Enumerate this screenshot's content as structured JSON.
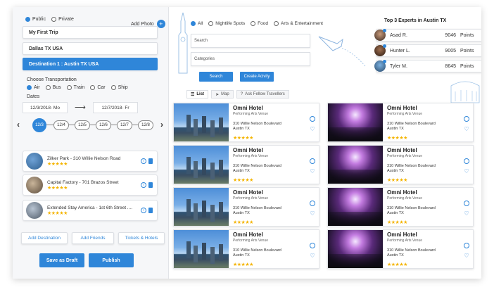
{
  "privacy": {
    "options": [
      "Public",
      "Private"
    ],
    "selected": "Public"
  },
  "add_photo_label": "Add Photo",
  "trip_name": "My First Trip",
  "origin": "Dallas TX USA",
  "destination": "Destination 1 : Austin TX USA",
  "transport": {
    "label": "Choose Transportation",
    "options": [
      "Air",
      "Bus",
      "Train",
      "Car",
      "Ship"
    ],
    "selected": "Air"
  },
  "dates": {
    "label": "Dates",
    "start": "12/3/2018- Mo",
    "end": "12/7/2018- Fr"
  },
  "timeline": [
    "12/3",
    "12/4",
    "12/5",
    "12/6",
    "12/7",
    "12/8"
  ],
  "timeline_active": "12/3",
  "destinations_list": [
    {
      "name": "Zilker Park - 310 Willie Nelson Road",
      "stars": "★★★★★"
    },
    {
      "name": "Capital Factory - 701 Brazos Street",
      "stars": "★★★★★"
    },
    {
      "name": "Extended Stay America - 1st 6th Street ....",
      "stars": "★★★★★"
    }
  ],
  "left_actions": {
    "add_destination": "Add Destination",
    "add_friends": "Add Friends",
    "tickets_hotels": "Tickets & Hotels",
    "save_draft": "Save as Draft",
    "publish": "Publish"
  },
  "filters": {
    "options": [
      "All",
      "Nightlife Spots",
      "Food",
      "Arts & Entertainment"
    ],
    "selected": "All"
  },
  "search": {
    "placeholder": "Search",
    "categories_placeholder": "Categories",
    "search_btn": "Search",
    "create_btn": "Create Acivity"
  },
  "experts": {
    "title": "Top 3 Experts in Austin TX",
    "points_label": "Points",
    "list": [
      {
        "name": "Asad R.",
        "points": "9046"
      },
      {
        "name": "Hunter L.",
        "points": "9005"
      },
      {
        "name": "Tyler M.",
        "points": "8645"
      }
    ]
  },
  "tabs": {
    "list": "List",
    "map": "Map",
    "ask": "Ask Fellow Travellers"
  },
  "hotels": [
    {
      "name": "Omni Hotel",
      "type": "Performing Arts Venue",
      "address": "310 Willie Nelson Boulevard",
      "city": "Austin TX",
      "stars": "★★★★★",
      "image": "skyline"
    },
    {
      "name": "Omni Hotel",
      "type": "Performing Arts Venue",
      "address": "310 Willie Nelson Boulevard",
      "city": "Austin TX",
      "stars": "★★★★★",
      "image": "concert"
    },
    {
      "name": "Omni Hotel",
      "type": "Performing Arts Venue",
      "address": "310 Willie Nelson Boulevard",
      "city": "Austin TX",
      "stars": "★★★★★",
      "image": "skyline"
    },
    {
      "name": "Omni Hotel",
      "type": "Performing Arts Venue",
      "address": "310 Willie Nelson Boulevard",
      "city": "Austin TX",
      "stars": "★★★★★",
      "image": "concert"
    },
    {
      "name": "Omni Hotel",
      "type": "Performing Arts Venue",
      "address": "310 Willie Nelson Boulevard",
      "city": "Austin TX",
      "stars": "★★★★★",
      "image": "skyline"
    },
    {
      "name": "Omni Hotel",
      "type": "Performing Arts Venue",
      "address": "310 Willie Nelson Boulevard",
      "city": "Austin TX",
      "stars": "★★★★★",
      "image": "concert"
    },
    {
      "name": "Omni Hotel",
      "type": "Performing Arts Venue",
      "address": "310 Willie Nelson Boulevard",
      "city": "Austin TX",
      "stars": "★★★★★",
      "image": "skyline"
    },
    {
      "name": "Omni Hotel",
      "type": "Performing Arts Venue",
      "address": "310 Willie Nelson Boulevard",
      "city": "Austin TX",
      "stars": "★★★★★",
      "image": "concert"
    }
  ],
  "colors": {
    "accent": "#2f86d9",
    "star": "#f4b400"
  }
}
